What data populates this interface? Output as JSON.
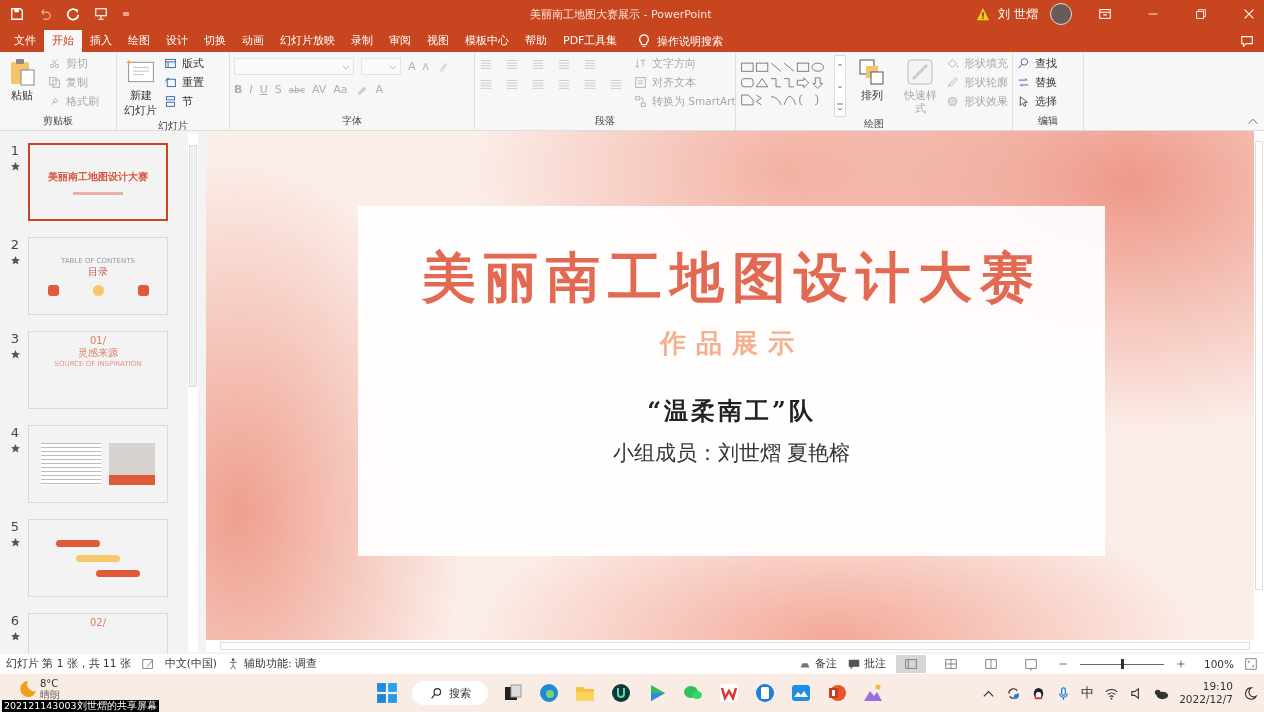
{
  "window": {
    "title": "美丽南工地图大赛展示 - PowerPoint",
    "user": "刘 世熠"
  },
  "tabs": [
    {
      "label": "文件",
      "selected": false
    },
    {
      "label": "开始",
      "selected": true
    },
    {
      "label": "插入",
      "selected": false
    },
    {
      "label": "绘图",
      "selected": false
    },
    {
      "label": "设计",
      "selected": false
    },
    {
      "label": "切换",
      "selected": false
    },
    {
      "label": "动画",
      "selected": false
    },
    {
      "label": "幻灯片放映",
      "selected": false
    },
    {
      "label": "录制",
      "selected": false
    },
    {
      "label": "审阅",
      "selected": false
    },
    {
      "label": "视图",
      "selected": false
    },
    {
      "label": "模板中心",
      "selected": false
    },
    {
      "label": "帮助",
      "selected": false
    },
    {
      "label": "PDF工具集",
      "selected": false
    }
  ],
  "tell_me": "操作说明搜索",
  "ribbon": [
    {
      "kind": "clipboard",
      "label": "剪贴板",
      "large": [
        {
          "label": "粘贴",
          "disabled": false
        }
      ],
      "small": [
        {
          "label": "剪切",
          "disabled": true
        },
        {
          "label": "复制",
          "disabled": true
        },
        {
          "label": "格式刷",
          "disabled": true
        }
      ]
    },
    {
      "kind": "slides",
      "label": "幻灯片",
      "large": [
        {
          "label": "新建",
          "label_2": "幻灯片",
          "disabled": false
        }
      ],
      "small": [
        {
          "label": "版式",
          "disabled": false
        },
        {
          "label": "重置",
          "disabled": false
        },
        {
          "label": "节",
          "disabled": false
        }
      ]
    },
    {
      "kind": "font",
      "label": "字体",
      "disabled": true,
      "size_buttons": [
        "A",
        "A"
      ],
      "format_buttons": [
        "B",
        "I",
        "U",
        "S",
        "abc",
        "AV",
        "Aa",
        "A"
      ]
    },
    {
      "kind": "paragraph",
      "label": "段落",
      "small": [
        {
          "label": "文字方向",
          "disabled": true
        },
        {
          "label": "对齐文本",
          "disabled": true
        },
        {
          "label": "转换为 SmartArt",
          "disabled": true
        }
      ]
    },
    {
      "kind": "drawing",
      "label": "绘图",
      "large": [
        {
          "label": "排列",
          "disabled": false
        },
        {
          "label": "快速样式",
          "disabled": true
        }
      ],
      "small": [
        {
          "label": "形状填充",
          "disabled": true
        },
        {
          "label": "形状轮廓",
          "disabled": true
        },
        {
          "label": "形状效果",
          "disabled": true
        }
      ]
    },
    {
      "kind": "editing",
      "label": "编辑",
      "small": [
        {
          "label": "查找",
          "disabled": false
        },
        {
          "label": "替换",
          "disabled": false
        },
        {
          "label": "选择",
          "disabled": false
        }
      ]
    }
  ],
  "thumbnails": [
    {
      "number": "1",
      "selected": true,
      "kind": "title",
      "texts": [
        "美丽南工地图设计大赛"
      ]
    },
    {
      "number": "2",
      "selected": false,
      "kind": "contents",
      "texts": [
        "TABLE OF CONTENTS",
        "目录"
      ]
    },
    {
      "number": "3",
      "selected": false,
      "kind": "section",
      "texts": [
        "01/",
        "灵感来源",
        "SOURCE OF INSPIRATION"
      ]
    },
    {
      "number": "4",
      "selected": false,
      "kind": "content"
    },
    {
      "number": "5",
      "selected": false,
      "kind": "steps"
    },
    {
      "number": "6",
      "selected": false,
      "kind": "section",
      "texts": [
        "02/"
      ]
    }
  ],
  "slide": {
    "title": "美丽南工地图设计大赛",
    "subtitle": "作品展示",
    "team": "“温柔南工”队",
    "members": "小组成员：刘世熠 夏艳榕"
  },
  "status_bar": {
    "slide_info": "幻灯片 第 1 张，共 11 张",
    "language": "中文(中国)",
    "accessibility": "辅助功能: 调查",
    "notes": "备注",
    "comments": "批注",
    "views": [
      {
        "selected": true
      },
      {
        "selected": false
      },
      {
        "selected": false
      },
      {
        "selected": false
      }
    ],
    "zoom": {
      "level": 0.5,
      "reading": "100%"
    }
  },
  "taskbar": {
    "temperature": "8°C",
    "condition": "晴朗",
    "search": "搜索",
    "ime": "中",
    "time": "19:10",
    "date": "2022/12/7"
  },
  "share_label": "202121143003刘世熠的共享屏幕"
}
